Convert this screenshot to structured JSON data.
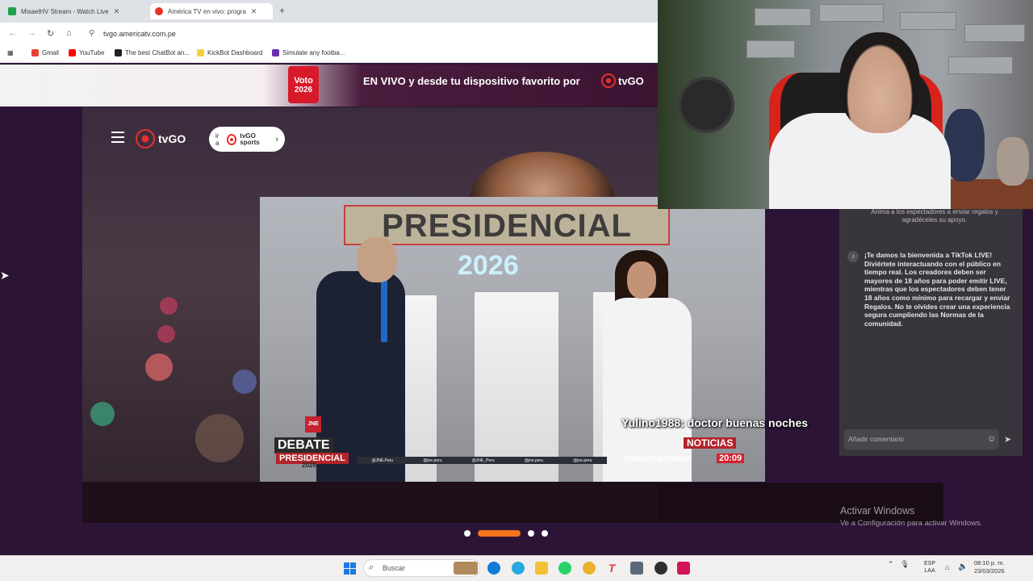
{
  "browser": {
    "tabs": [
      {
        "title": "MisaelHV Stream - Watch Live",
        "active": false
      },
      {
        "title": "América TV en vivo: progra",
        "active": true
      }
    ],
    "url": "tvgo.americatv.com.pe",
    "bookmarks": [
      {
        "label": "Gmail",
        "color": "#e94235"
      },
      {
        "label": "YouTube",
        "color": "#ff0000"
      },
      {
        "label": "The best ChatBot an...",
        "color": "#222222"
      },
      {
        "label": "KickBot Dashboard",
        "color": "#f4d03f"
      },
      {
        "label": "Simulate any footba...",
        "color": "#6a2fb0"
      }
    ]
  },
  "site": {
    "promo_badge_line1": "Voto",
    "promo_badge_line2": "2026",
    "promo_text": "EN VIVO y desde tu dispositivo favorito por",
    "brand": "tvGO",
    "sports_prefix": "ir a",
    "sports_brand": "tvGO sports"
  },
  "video": {
    "banner_title": "PRESIDENCIAL",
    "banner_year": "2026",
    "debate_label": "DEBATE",
    "debate_sub": "PRESIDENCIAL",
    "debate_year": "2026",
    "jne": "JNE",
    "ticker": [
      "@JNE.Peru",
      "@jne.peru",
      "@JNE_Peru",
      "@jne.peru",
      "@jne.peru"
    ],
    "noticias": "NOTICIAS",
    "handle": "@americanoticias",
    "time": "20:09"
  },
  "chat_overlay": "Yulino1988: doctor buenas noches",
  "tiktok": {
    "top_text": "Anima a los espectadores a enviar regalos y agradéceles su apoyo.",
    "welcome": "¡Te damos la bienvenida a TikTok LIVE! Diviértete interactuando con el público en tiempo real. Los creadores deben ser mayores de 18 años para poder emitir LIVE, mientras que los espectadores deben tener 18 años como mínimo para recargar y enviar Regalos. No te olvides crear una experiencia segura cumpliendo las Normas de la comunidad.",
    "comment_placeholder": "Añadir comentario"
  },
  "windows": {
    "activate_title": "Activar Windows",
    "activate_sub": "Ve a Configuración para activar Windows.",
    "search_placeholder": "Buscar",
    "lang_line1": "ESP",
    "lang_line2": "LAA",
    "time": "08:10 p. m.",
    "date": "23/03/2026"
  },
  "colors": {
    "accent_orange": "#f5731a",
    "brand_red": "#e8302a",
    "page_purple": "#2c1436"
  }
}
